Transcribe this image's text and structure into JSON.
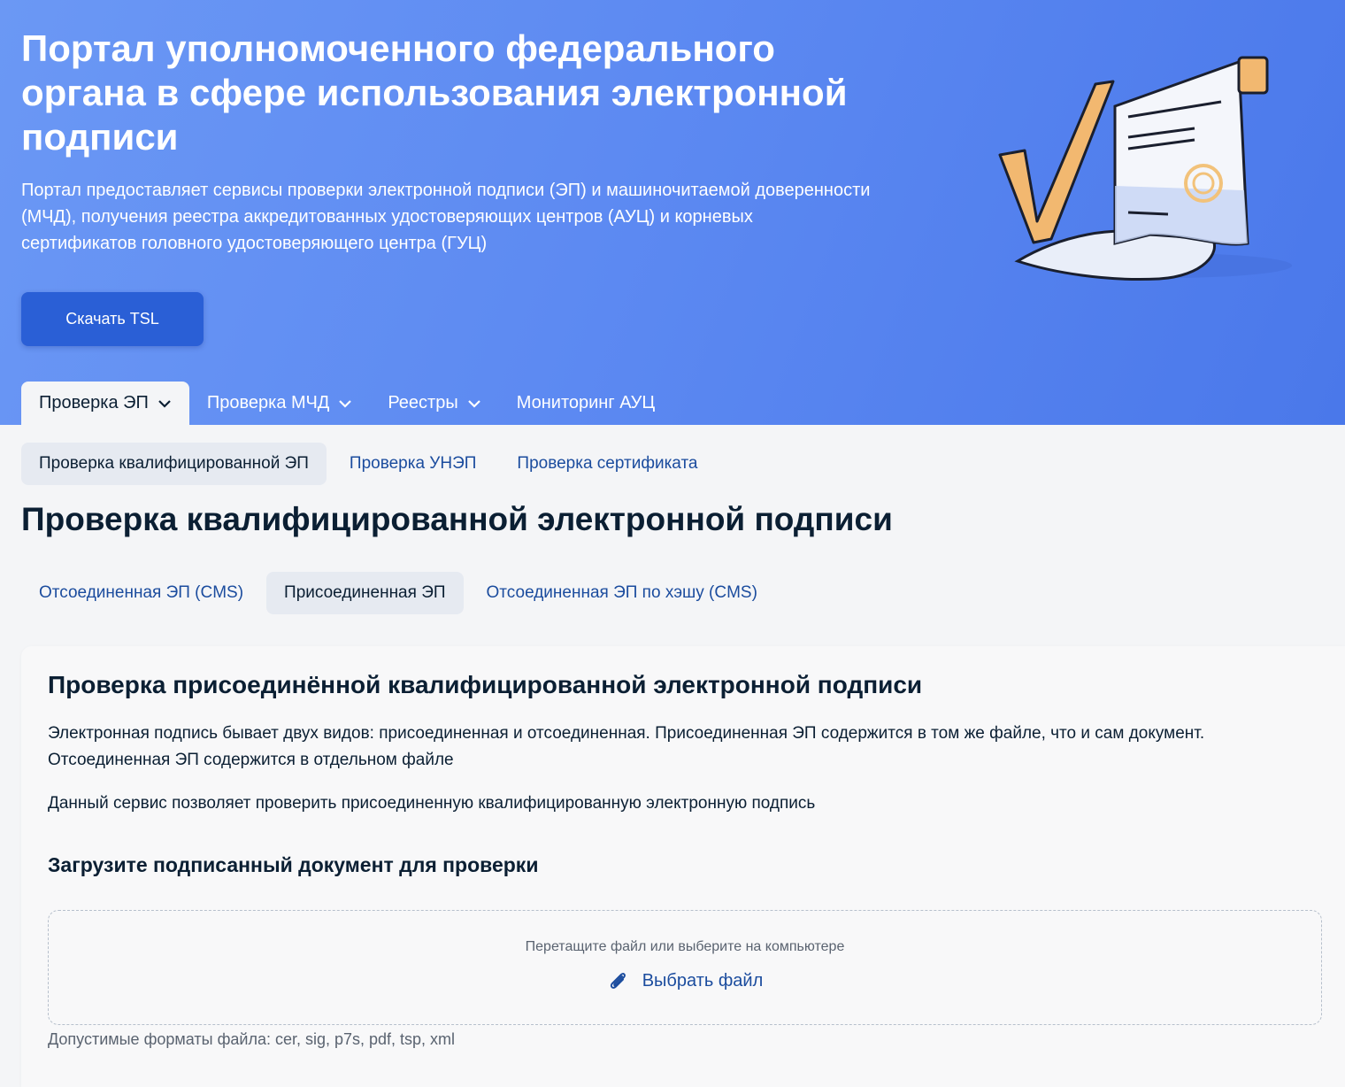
{
  "hero": {
    "title": "Портал уполномоченного федерального органа в сфере использования электронной подписи",
    "description": "Портал предоставляет сервисы проверки электронной подписи (ЭП) и машиночитаемой доверенности (МЧД), получения реестра аккредитованных удостоверяющих центров (АУЦ) и корневых сертификатов головного удостоверяющего центра (ГУЦ)",
    "download_button": "Скачать TSL"
  },
  "main_tabs": [
    {
      "label": "Проверка ЭП",
      "active": true,
      "icon": "chevron-down-icon"
    },
    {
      "label": "Проверка МЧД",
      "active": false,
      "icon": "chevron-down-icon"
    },
    {
      "label": "Реестры",
      "active": false,
      "icon": "chevron-down-icon"
    },
    {
      "label": "Мониторинг АУЦ",
      "active": false
    }
  ],
  "sub_tabs": [
    {
      "label": "Проверка квалифицированной ЭП",
      "active": true
    },
    {
      "label": "Проверка УНЭП",
      "active": false
    },
    {
      "label": "Проверка сертификата",
      "active": false
    }
  ],
  "page_title": "Проверка квалифицированной электронной подписи",
  "signature_tabs": [
    {
      "label": "Отсоединенная ЭП (CMS)",
      "active": false
    },
    {
      "label": "Присоединенная ЭП",
      "active": true
    },
    {
      "label": "Отсоединенная ЭП по хэшу (CMS)",
      "active": false
    }
  ],
  "card": {
    "title": "Проверка присоединённой квалифицированной электронной подписи",
    "paragraph1": "Электронная подпись бывает двух видов: присоединенная и отсоединенная. Присоединенная ЭП содержится в том же файле, что и сам документ. Отсоединенная ЭП содержится в отдельном файле",
    "paragraph2": "Данный сервис позволяет проверить присоединенную квалифицированную электронную подпись",
    "upload_title": "Загрузите подписанный документ для проверки",
    "drop_hint": "Перетащите файл или выберите на компьютере",
    "choose_file": "Выбрать файл",
    "choose_icon": "paperclip-icon",
    "formats": "Допустимые форматы файла: cer, sig, p7s, pdf, tsp, xml"
  },
  "colors": {
    "hero_start": "#6b98f4",
    "hero_end": "#4a78ea",
    "button": "#2a5fd6",
    "link": "#1b4c9e",
    "text": "#0b1f33"
  }
}
